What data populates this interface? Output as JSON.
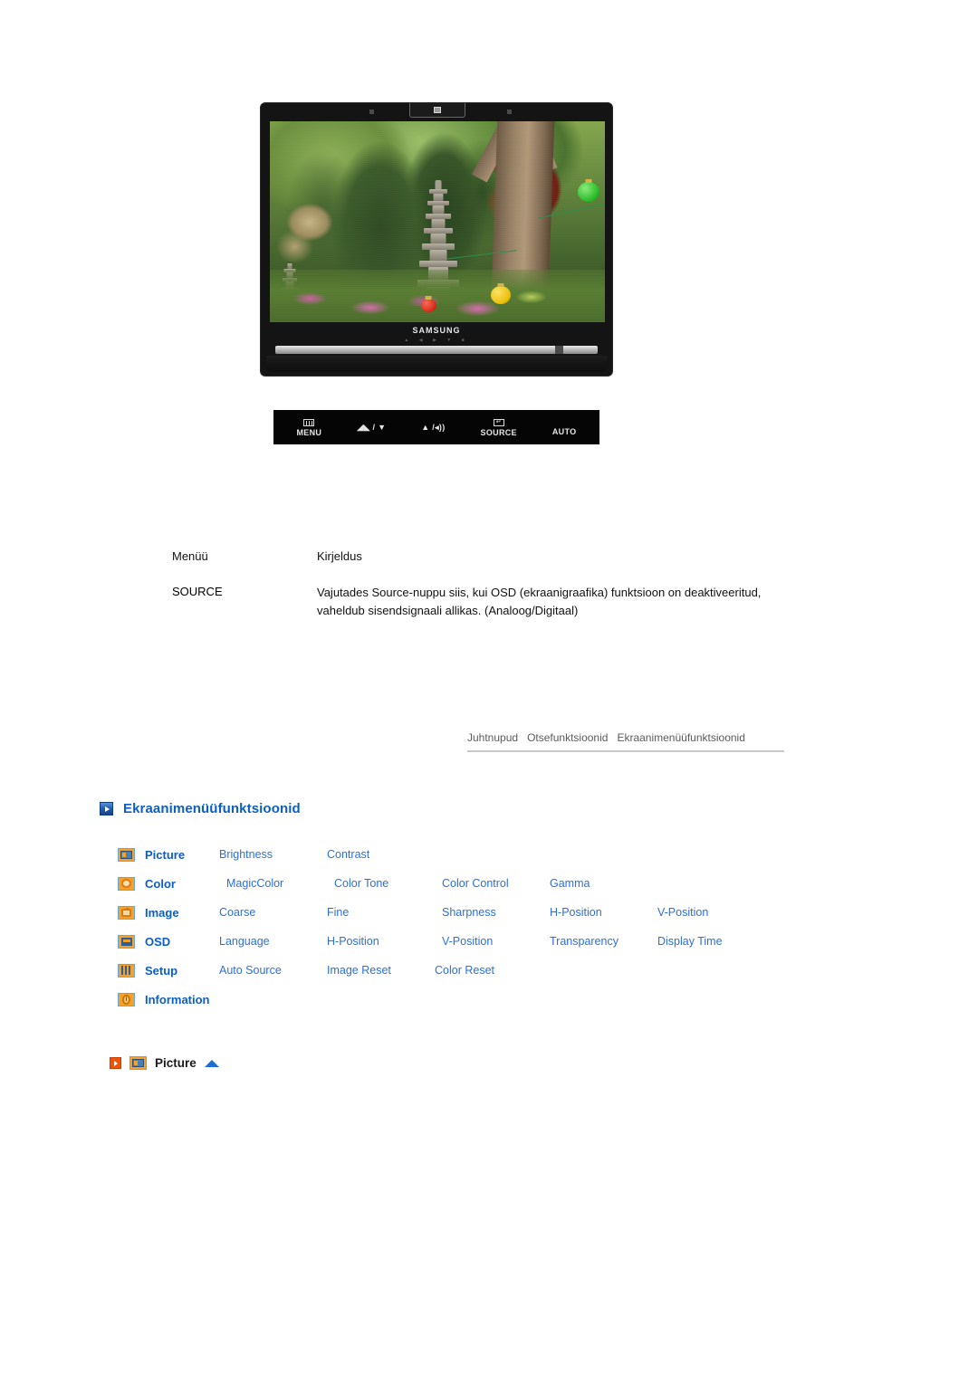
{
  "monitor": {
    "brand": "SAMSUNG",
    "bezel_logo_icon": "samsung-bezel-indicator-icon",
    "screen_caption": "garden-scene-with-stone-pagoda-and-lanterns"
  },
  "button_bar": {
    "buttons": [
      {
        "glyph_icon": "menu-lines-icon",
        "label": "MENU"
      },
      {
        "glyph_icon": "brightness-down-icon",
        "label": ""
      },
      {
        "glyph_icon": "volume-up-icon",
        "label": ""
      },
      {
        "glyph_icon": "source-enter-icon",
        "label": "SOURCE"
      },
      {
        "glyph_icon": "",
        "label": "AUTO"
      }
    ],
    "brightness_label": "◢◣ / ▼",
    "volume_label": "▲ /◂))",
    "auto_label": "AUTO",
    "menu_label": "MENU",
    "source_label": "SOURCE"
  },
  "table": {
    "headers": {
      "menu": "Menüü",
      "description": "Kirjeldus"
    },
    "rows": [
      {
        "menu": "SOURCE",
        "description": "Vajutades Source-nuppu siis, kui OSD (ekraanigraafika) funktsioon on deaktiveeritud, vaheldub sisendsignaali allikas. (Analoog/Digitaal)"
      }
    ]
  },
  "tabs": [
    {
      "label": "Juhtnupud"
    },
    {
      "label": "Otsefunktsioonid"
    },
    {
      "label": "Ekraanimenüüfunktsioonid"
    }
  ],
  "section": {
    "icon": "blue-play-icon",
    "title": "Ekraanimenüüfunktsioonid"
  },
  "osd_matrix": {
    "rows": [
      {
        "icon": "picture-icon",
        "category": "Picture",
        "items": [
          "Brightness",
          "Contrast"
        ]
      },
      {
        "icon": "color-icon",
        "category": "Color",
        "items": [
          "MagicColor",
          "Color Tone",
          "Color Control",
          "Gamma"
        ]
      },
      {
        "icon": "image-icon",
        "category": "Image",
        "items": [
          "Coarse",
          "Fine",
          "Sharpness",
          "H-Position",
          "V-Position"
        ]
      },
      {
        "icon": "osd-icon",
        "category": "OSD",
        "items": [
          "Language",
          "H-Position",
          "V-Position",
          "Transparency",
          "Display Time"
        ]
      },
      {
        "icon": "setup-icon",
        "category": "Setup",
        "items": [
          "Auto Source",
          "Image Reset",
          "Color Reset"
        ]
      },
      {
        "icon": "information-icon",
        "category": "Information",
        "items": []
      }
    ]
  },
  "picture_heading": {
    "play_icon": "orange-play-icon",
    "category_icon": "picture-icon",
    "title": "Picture",
    "arrow_icon": "blue-up-triangle-icon"
  },
  "colors": {
    "section_title": "#0b5ec4",
    "menu_item": "#2a6fe0",
    "tab_text": "#5b5b5b",
    "orange_accent": "#ee5508",
    "icon_orange": "#f2a22a"
  }
}
